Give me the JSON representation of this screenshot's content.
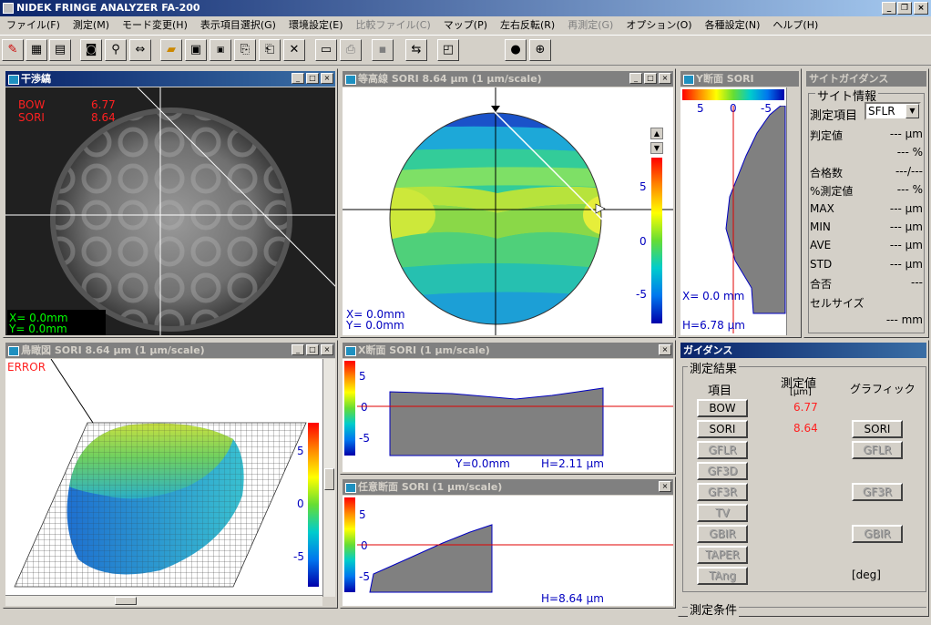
{
  "app": {
    "title": "NIDEK FRINGE ANALYZER FA-200"
  },
  "menu": [
    {
      "label": "ファイル(F)",
      "enabled": true
    },
    {
      "label": "測定(M)",
      "enabled": true
    },
    {
      "label": "モード変更(H)",
      "enabled": true
    },
    {
      "label": "表示項目選択(G)",
      "enabled": true
    },
    {
      "label": "環境設定(E)",
      "enabled": true
    },
    {
      "label": "比較ファイル(C)",
      "enabled": false
    },
    {
      "label": "マップ(P)",
      "enabled": true
    },
    {
      "label": "左右反転(R)",
      "enabled": true
    },
    {
      "label": "再測定(G)",
      "enabled": false
    },
    {
      "label": "オプション(O)",
      "enabled": true
    },
    {
      "label": "各種設定(N)",
      "enabled": true
    },
    {
      "label": "ヘルプ(H)",
      "enabled": true
    }
  ],
  "interferogram": {
    "title": "干渉縞",
    "bow_label": "BOW",
    "bow_value": "6.77",
    "sori_label": "SORI",
    "sori_value": "8.64",
    "x_readout": "X=   0.0mm",
    "y_readout": "Y=   0.0mm"
  },
  "contour": {
    "title": "等高線 SORI 8.64 μm (1 μm/scale)",
    "x_readout": "X=   0.0mm",
    "y_readout": "Y=   0.0mm",
    "scale_ticks": [
      "5",
      "0",
      "-5"
    ]
  },
  "ysection": {
    "title": "Y断面 SORI",
    "ticks": [
      "5",
      "0",
      "-5"
    ],
    "x_readout": "X=   0.0  mm",
    "h_readout": "H=6.78 μm"
  },
  "site_guidance": {
    "title": "サイトガイダンス",
    "group": "サイト情報",
    "measure_item_label": "測定項目",
    "measure_item_value": "SFLR",
    "rows": [
      {
        "label": "判定値",
        "value": "--- μm"
      },
      {
        "label": "",
        "value": "--- %"
      },
      {
        "label": "合格数",
        "value": "---/---"
      },
      {
        "label": "%測定値",
        "value": "--- %"
      },
      {
        "label": "MAX",
        "value": "--- μm"
      },
      {
        "label": "MIN",
        "value": "--- μm"
      },
      {
        "label": "AVE",
        "value": "--- μm"
      },
      {
        "label": "STD",
        "value": "--- μm"
      },
      {
        "label": "合否",
        "value": "---"
      },
      {
        "label": "セルサイズ",
        "value": ""
      },
      {
        "label": "",
        "value": "--- mm"
      }
    ]
  },
  "birdseye": {
    "title": "鳥瞰図 SORI 8.64 μm (1 μm/scale)",
    "error": "ERROR",
    "ticks": [
      "5",
      "0",
      "-5"
    ]
  },
  "xsection": {
    "title": "X断面 SORI (1 μm/scale)",
    "ticks": [
      "5",
      "0",
      "-5"
    ],
    "y_readout": "Y=0.0mm",
    "h_readout": "H=2.11 μm"
  },
  "anysection": {
    "title": "任意断面 SORI (1 μm/scale)",
    "ticks": [
      "5",
      "0",
      "-5"
    ],
    "h_readout": "H=8.64 μm"
  },
  "guidance": {
    "title": "ガイダンス",
    "results_group": "測定結果",
    "col_item": "項目",
    "col_value": "測定値",
    "col_value_unit": "[μm]",
    "col_graphic": "グラフィック",
    "items": [
      {
        "label": "BOW",
        "value": "6.77",
        "enabled": true,
        "graphic": ""
      },
      {
        "label": "SORI",
        "value": "8.64",
        "enabled": true,
        "graphic": "SORI"
      },
      {
        "label": "GFLR",
        "value": "",
        "enabled": false,
        "graphic": "GFLR"
      },
      {
        "label": "GF3D",
        "value": "",
        "enabled": false,
        "graphic": ""
      },
      {
        "label": "GF3R",
        "value": "",
        "enabled": false,
        "graphic": "GF3R"
      },
      {
        "label": "TV",
        "value": "",
        "enabled": false,
        "graphic": ""
      },
      {
        "label": "GBIR",
        "value": "",
        "enabled": false,
        "graphic": "GBIR"
      },
      {
        "label": "TAPER",
        "value": "",
        "enabled": false,
        "graphic": ""
      },
      {
        "label": "TAng",
        "value": "",
        "enabled": false,
        "graphic": "[deg]"
      }
    ],
    "conditions_group": "測定条件"
  },
  "colors": {
    "title_active": "#0a246a",
    "readout_red": "#ff2020",
    "readout_blue": "#0000c0",
    "readout_green": "#00ff00"
  }
}
